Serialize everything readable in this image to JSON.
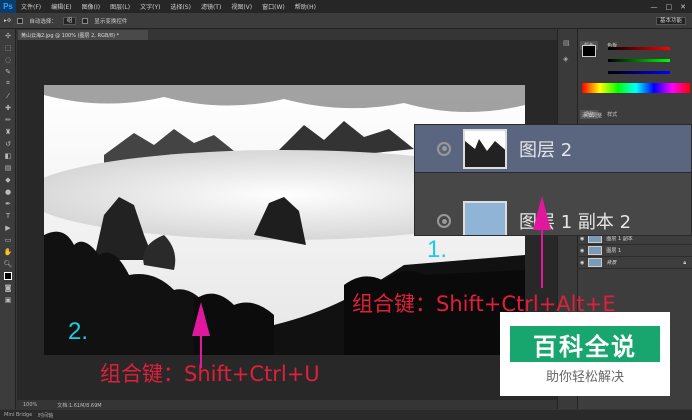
{
  "app": {
    "logo": "Ps"
  },
  "menu": [
    "文件(F)",
    "编辑(E)",
    "图像(I)",
    "图层(L)",
    "文字(Y)",
    "选择(S)",
    "滤镜(T)",
    "视图(V)",
    "窗口(W)",
    "帮助(H)"
  ],
  "window_controls": [
    "—",
    "□",
    "✕"
  ],
  "options": {
    "auto_select_label": "自动选择：",
    "auto_select_value": "组",
    "show_transform_label": "显示变换控件",
    "workspace": "基本功能"
  },
  "document": {
    "tab_title": "黄山云海2.jpg @ 100% (图层 2, RGB/8) *",
    "zoom": "100%",
    "doc_info": "文档:1.61M/8.69M"
  },
  "bottom_tabs": [
    "Mini Bridge",
    "时间轴"
  ],
  "panels": {
    "color_tab": "颜色",
    "swatches_tab": "色板",
    "adjust_tab": "调整",
    "style_tab": "样式",
    "add_adjust": "添加调整"
  },
  "zoom_popup": {
    "layers": [
      {
        "name": "图层 2"
      },
      {
        "name": "图层 1 副本 2"
      }
    ]
  },
  "layers_mini": [
    {
      "name": "图层 1 副本"
    },
    {
      "name": "图层 1"
    },
    {
      "name": "背景"
    }
  ],
  "annotations": {
    "step1_number": "1.",
    "step1_text": "组合键：Shift+Ctrl+Alt+E",
    "step2_number": "2.",
    "step2_text": "组合键：Shift+Ctrl+U",
    "arrow_color": "#e0189e"
  },
  "watermark": {
    "title": "百科全说",
    "subtitle": "助你轻松解决"
  },
  "colors": {
    "accent_green": "#19a66e",
    "annotation_red": "#e0203a",
    "annotation_cyan": "#1ecbe1"
  }
}
